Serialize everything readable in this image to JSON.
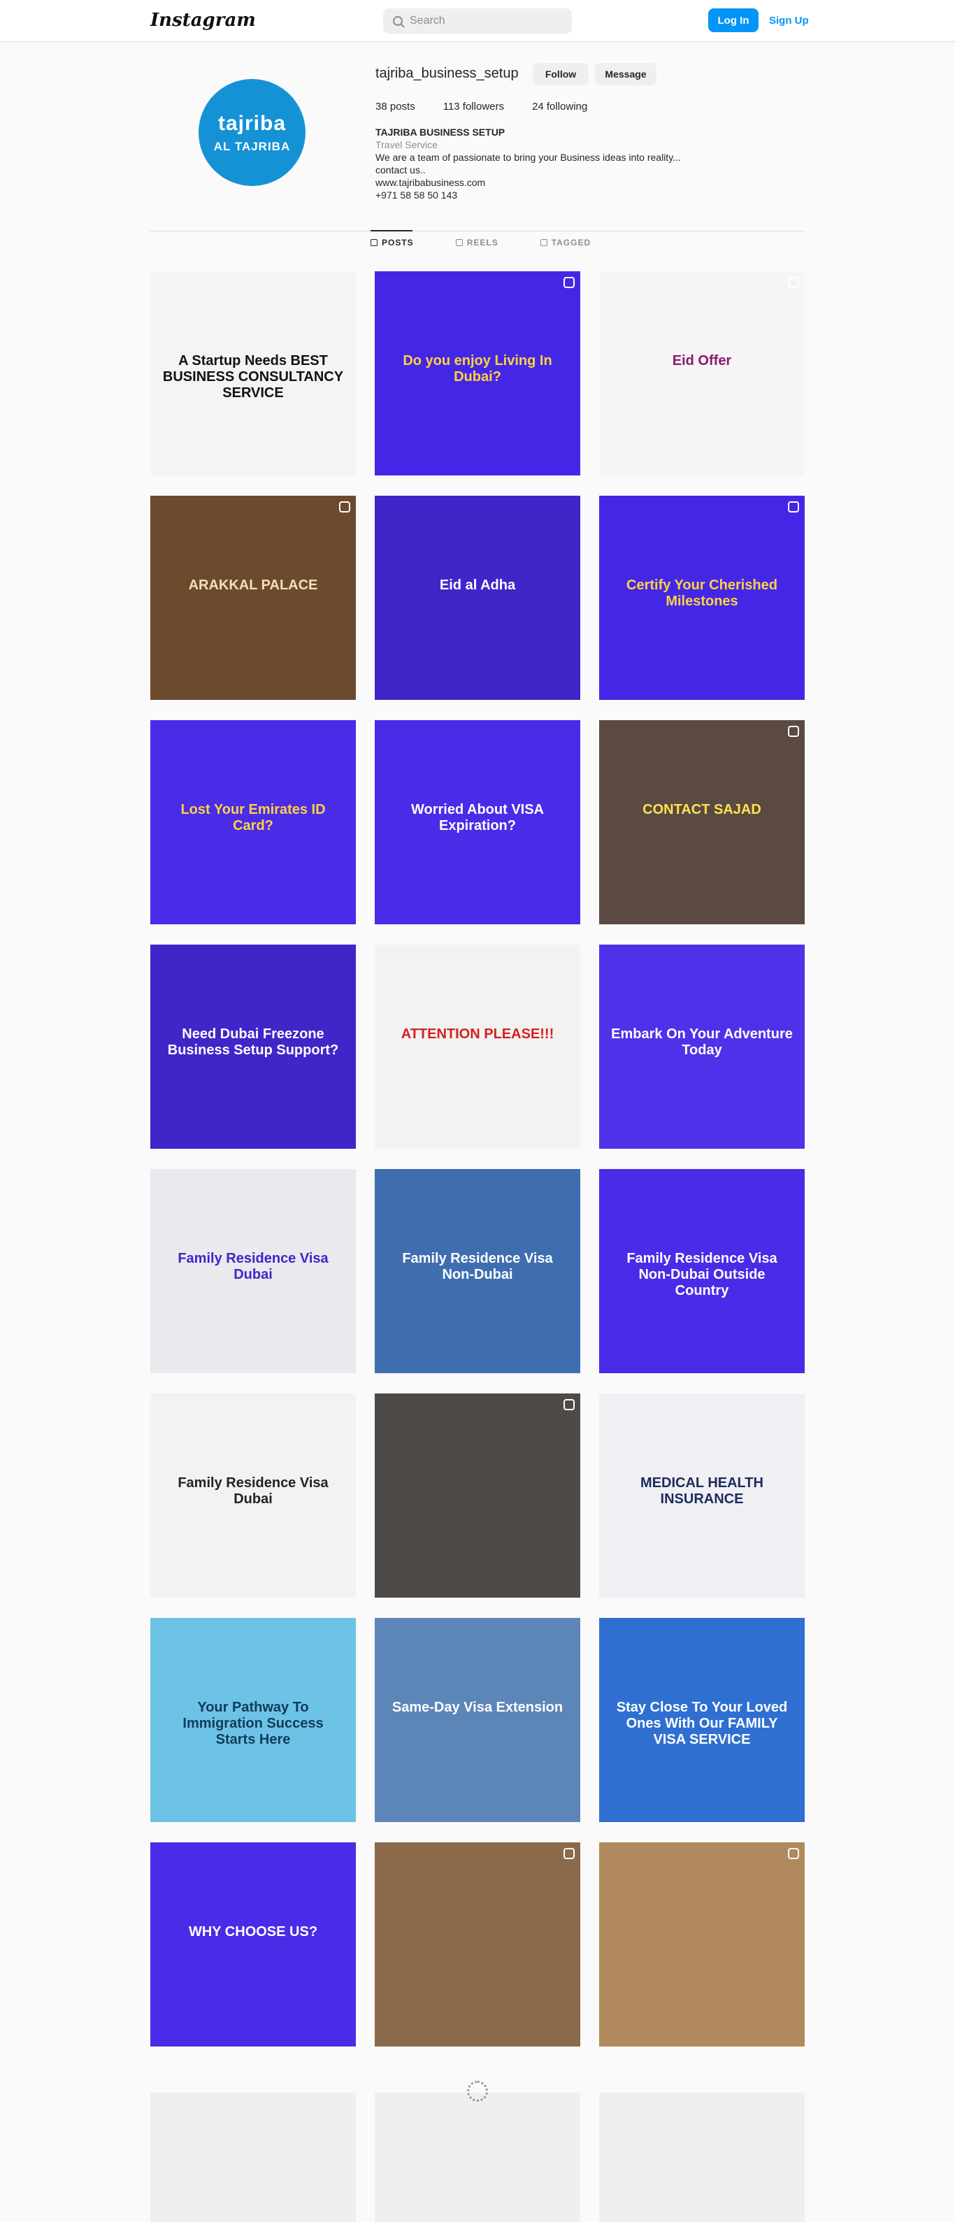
{
  "header": {
    "logo": "Instagram",
    "search_placeholder": "Search",
    "login_label": "Log In",
    "signup_label": "Sign Up"
  },
  "profile": {
    "avatar_line1": "tajriba",
    "avatar_line2": "AL TAJRIBA",
    "username": "tajriba_business_setup",
    "follow_label": "Follow",
    "message_label": "Message",
    "posts": "38 posts",
    "followers": "113 followers",
    "following": "24 following",
    "full_name": "TAJRIBA BUSINESS SETUP",
    "category": "Travel Service",
    "bio_line1": "We are a team of passionate to bring your Business ideas into reality...",
    "bio_line2": "contact us..",
    "website": "www.tajribabusiness.com",
    "phone": "+971 58 58 50 143"
  },
  "tabs": [
    "POSTS",
    "REELS",
    "TAGGED"
  ],
  "posts": [
    {
      "text": "A Startup Needs BEST BUSINESS CONSULTANCY SERVICE",
      "bg": "#f4f4f4",
      "fg": "#111"
    },
    {
      "text": "Do you enjoy Living In Dubai?",
      "bg": "#4427e6",
      "fg": "#ffd23f"
    },
    {
      "text": "Eid Offer",
      "bg": "#f5f5f5",
      "fg": "#8a1a6b"
    },
    {
      "text": "ARAKKAL PALACE",
      "bg": "#6b4a2e",
      "fg": "#f3e0b5"
    },
    {
      "text": "Eid al Adha",
      "bg": "#3e26c9",
      "fg": "#ffffff"
    },
    {
      "text": "Certify Your Cherished Milestones",
      "bg": "#4427e6",
      "fg": "#ffd23f"
    },
    {
      "text": "Lost Your Emirates ID Card?",
      "bg": "#4a2be8",
      "fg": "#ffd23f"
    },
    {
      "text": "Worried About VISA Expiration?",
      "bg": "#4a2be8",
      "fg": "#ffffff"
    },
    {
      "text": "CONTACT SAJAD",
      "bg": "#5a4a42",
      "fg": "#ffe14d"
    },
    {
      "text": "Need Dubai Freezone Business Setup Support?",
      "bg": "#3e26c9",
      "fg": "#ffffff"
    },
    {
      "text": "ATTENTION PLEASE!!!",
      "bg": "#f2f2f2",
      "fg": "#d61f1f"
    },
    {
      "text": "Embark On Your Adventure Today",
      "bg": "#4f31ea",
      "fg": "#ffffff"
    },
    {
      "text": "Family Residence Visa Dubai",
      "bg": "#e9e9ee",
      "fg": "#3e26c9"
    },
    {
      "text": "Family Residence Visa Non-Dubai",
      "bg": "#3f6eb0",
      "fg": "#ffffff"
    },
    {
      "text": "Family Residence Visa Non-Dubai Outside Country",
      "bg": "#4a2be8",
      "fg": "#ffffff"
    },
    {
      "text": "Family Residence Visa Dubai",
      "bg": "#f2f2f2",
      "fg": "#222"
    },
    {
      "text": "",
      "bg": "#4d4a48",
      "fg": "#fff"
    },
    {
      "text": "MEDICAL HEALTH INSURANCE",
      "bg": "#eef0f3",
      "fg": "#1e2a5a"
    },
    {
      "text": "Your Pathway To Immigration Success Starts Here",
      "bg": "#6cc3e6",
      "fg": "#0f3c5a"
    },
    {
      "text": "Same-Day Visa Extension",
      "bg": "#5d86b8",
      "fg": "#ffffff"
    },
    {
      "text": "Stay Close To Your Loved Ones With Our FAMILY VISA SERVICE",
      "bg": "#2f6fd1",
      "fg": "#ffffff"
    },
    {
      "text": "WHY CHOOSE US?",
      "bg": "#4a2be8",
      "fg": "#ffffff"
    },
    {
      "text": "",
      "bg": "#8a6a4a",
      "fg": "#fff"
    },
    {
      "text": "",
      "bg": "#b08a5c",
      "fg": "#fff"
    }
  ]
}
